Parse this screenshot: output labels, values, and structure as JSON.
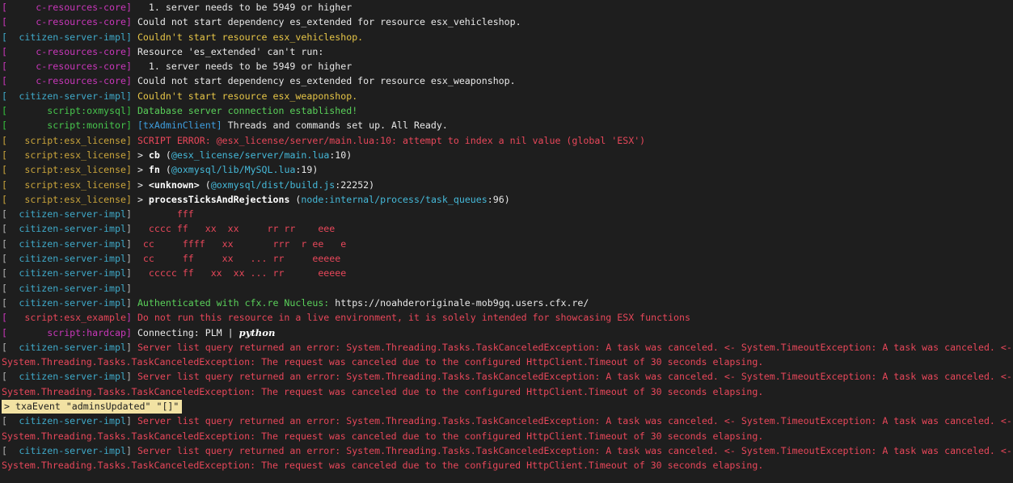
{
  "colors": {
    "background": "#1e1e1e",
    "magenta": "#c837b9",
    "cyan": "#3fa9c9",
    "green": "#47c54d",
    "yellow": "#c9a43b",
    "red": "#e8475a",
    "input_highlight": "#f2e2a3"
  },
  "console": {
    "l1": {
      "tag": "c-resources-core",
      "msg": "  1. server needs to be 5949 or higher"
    },
    "l2": {
      "tag": "c-resources-core",
      "msg": "Could not start dependency es_extended for resource esx_vehicleshop."
    },
    "l3": {
      "tag": "citizen-server-impl",
      "msg": "Couldn't start resource esx_vehicleshop."
    },
    "l4": {
      "tag": "c-resources-core",
      "msg": "Resource 'es_extended' can't run:"
    },
    "l5": {
      "tag": "c-resources-core",
      "msg": "  1. server needs to be 5949 or higher"
    },
    "l6": {
      "tag": "c-resources-core",
      "msg": "Could not start dependency es_extended for resource esx_weaponshop."
    },
    "l7": {
      "tag": "citizen-server-impl",
      "msg": "Couldn't start resource esx_weaponshop."
    },
    "l8": {
      "tag": "script:oxmysql",
      "msg": "Database server connection established!"
    },
    "l9": {
      "tag": "script:monitor",
      "prefix": "[txAdminClient]",
      "msg": " Threads and commands set up. All Ready."
    },
    "l10": {
      "tag": "script:esx_license",
      "msg": "SCRIPT ERROR: @esx_license/server/main.lua:10: attempt to index a nil value (global 'ESX')"
    },
    "l11": {
      "tag": "script:esx_license",
      "arrow": "> ",
      "fn": "cb",
      "open": " (",
      "path": "@esx_license/server/main.lua",
      "line": ":10",
      "close": ")"
    },
    "l12": {
      "tag": "script:esx_license",
      "arrow": "> ",
      "fn": "fn",
      "open": " (",
      "path": "@oxmysql/lib/MySQL.lua",
      "line": ":19",
      "close": ")"
    },
    "l13": {
      "tag": "script:esx_license",
      "arrow": "> ",
      "fn": "<unknown>",
      "open": " (",
      "path": "@oxmysql/dist/build.js",
      "line": ":22252",
      "close": ")"
    },
    "l14": {
      "tag": "script:esx_license",
      "arrow": "> ",
      "fn": "processTicksAndRejections",
      "open": " (",
      "path": "node:internal/process/task_queues",
      "line": ":96",
      "close": ")"
    },
    "l15": {
      "tag": "citizen-server-impl",
      "msg": "       fff"
    },
    "l16": {
      "tag": "citizen-server-impl",
      "msg": "  cccc ff   xx  xx     rr rr    eee"
    },
    "l17": {
      "tag": "citizen-server-impl",
      "msg": " cc     ffff   xx       rrr  r ee   e"
    },
    "l18": {
      "tag": "citizen-server-impl",
      "msg": " cc     ff     xx   ... rr     eeeee"
    },
    "l19": {
      "tag": "citizen-server-impl",
      "msg": "  ccccc ff   xx  xx ... rr      eeeee"
    },
    "l20": {
      "tag": "citizen-server-impl",
      "msg": ""
    },
    "l21": {
      "tag": "citizen-server-impl",
      "msg_green": "Authenticated with cfx.re Nucleus: ",
      "url": "https://noahderoriginale-mob9gq.users.cfx.re/"
    },
    "l22": {
      "tag": "script:esx_example",
      "msg": "Do not run this resource in a live environment, it is solely intended for showcasing ESX functions"
    },
    "l23": {
      "tag": "script:hardcap",
      "msg": "Connecting: PLM | ",
      "signature": "python"
    },
    "err1": {
      "tag": "citizen-server-impl",
      "part1": "Server list query returned an error: System.Threading.Tasks.TaskCanceledException: A task was canceled. <- System.TimeoutException: A task was canceled. <-",
      "part2": "System.Threading.Tasks.TaskCanceledException: The request was canceled due to the configured HttpClient.Timeout of 30 seconds elapsing."
    },
    "err2": {
      "tag": "citizen-server-impl",
      "part1": "Server list query returned an error: System.Threading.Tasks.TaskCanceledException: A task was canceled. <- System.TimeoutException: A task was canceled. <-",
      "part2": "System.Threading.Tasks.TaskCanceledException: The request was canceled due to the configured HttpClient.Timeout of 30 seconds elapsing."
    },
    "input": "> txaEvent \"adminsUpdated\" \"[]\"",
    "err3": {
      "tag": "citizen-server-impl",
      "part1": "Server list query returned an error: System.Threading.Tasks.TaskCanceledException: A task was canceled. <- System.TimeoutException: A task was canceled. <-",
      "part2": "System.Threading.Tasks.TaskCanceledException: The request was canceled due to the configured HttpClient.Timeout of 30 seconds elapsing."
    },
    "err4": {
      "tag": "citizen-server-impl",
      "part1": "Server list query returned an error: System.Threading.Tasks.TaskCanceledException: A task was canceled. <- System.TimeoutException: A task was canceled. <-",
      "part2": "System.Threading.Tasks.TaskCanceledException: The request was canceled due to the configured HttpClient.Timeout of 30 seconds elapsing."
    }
  }
}
